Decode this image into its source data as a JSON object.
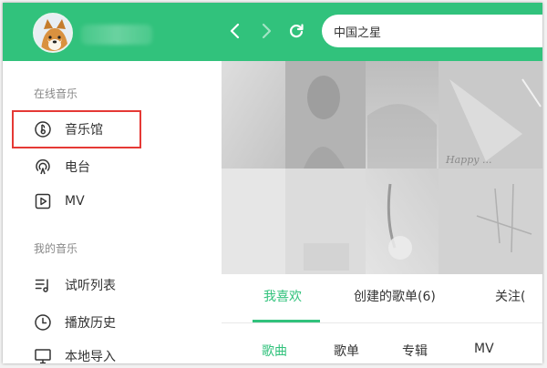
{
  "colors": {
    "accent": "#31c27c",
    "highlight": "#e53935"
  },
  "header": {
    "avatar_icon": "shiba-dog-avatar",
    "search": {
      "value": "中国之星"
    }
  },
  "sidebar": {
    "online_section_title": "在线音乐",
    "online_items": [
      {
        "label": "音乐馆",
        "icon": "music-note-circle-icon",
        "highlighted": true
      },
      {
        "label": "电台",
        "icon": "radio-icon"
      },
      {
        "label": "MV",
        "icon": "play-video-icon"
      }
    ],
    "my_section_title": "我的音乐",
    "my_items": [
      {
        "label": "试听列表",
        "icon": "playlist-icon"
      },
      {
        "label": "播放历史",
        "icon": "clock-icon"
      },
      {
        "label": "本地导入",
        "icon": "monitor-icon"
      }
    ]
  },
  "main": {
    "tabs": [
      {
        "label": "我喜欢",
        "active": true
      },
      {
        "label": "创建的歌单(6)"
      },
      {
        "label": "关注("
      }
    ],
    "subtabs": [
      {
        "label": "歌曲",
        "active": true
      },
      {
        "label": "歌单"
      },
      {
        "label": "专辑"
      },
      {
        "label": "MV"
      }
    ]
  }
}
